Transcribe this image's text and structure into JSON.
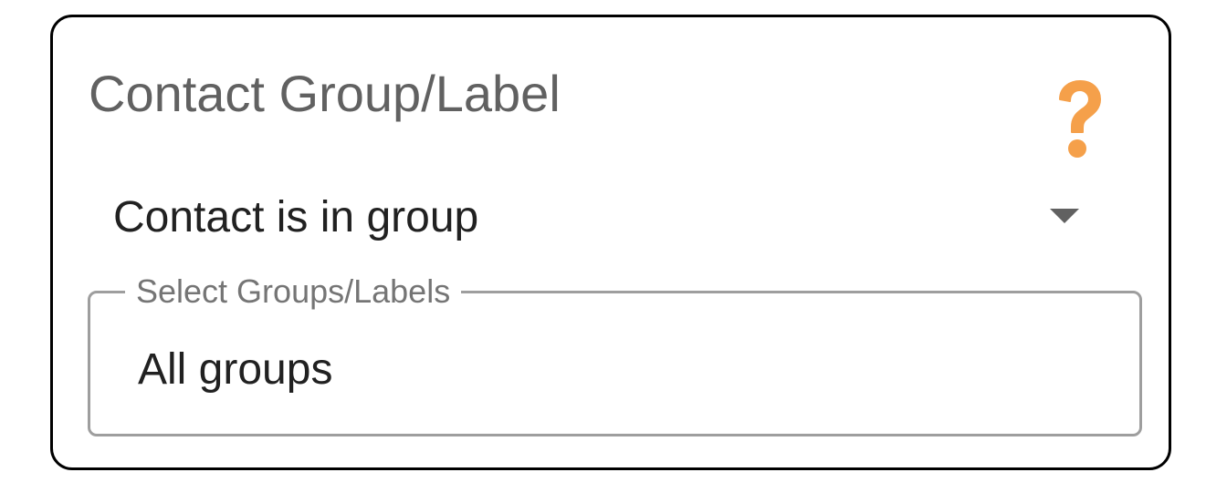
{
  "card": {
    "title": "Contact Group/Label",
    "help_icon": "question-mark-icon",
    "help_color": "#f5a04a"
  },
  "condition_select": {
    "value": "Contact is in group",
    "icon": "caret-down-icon"
  },
  "groups_field": {
    "label": "Select Groups/Labels",
    "value": "All groups"
  }
}
